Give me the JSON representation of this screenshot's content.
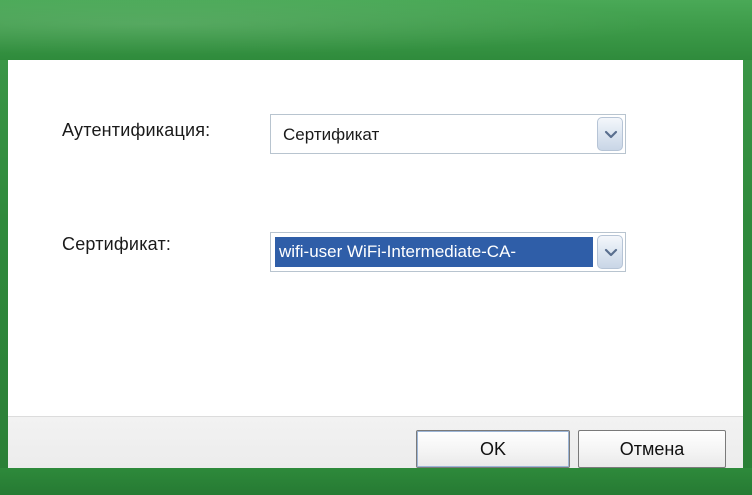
{
  "form": {
    "auth_label": "Аутентификация:",
    "auth_value": "Сертификат",
    "cert_label": "Сертификат:",
    "cert_value": "wifi-user WiFi-Intermediate-CA-"
  },
  "buttons": {
    "ok": "OK",
    "cancel": "Отмена"
  },
  "colors": {
    "frame_green": "#2f8a3c",
    "selection_blue": "#2f5ea8"
  }
}
